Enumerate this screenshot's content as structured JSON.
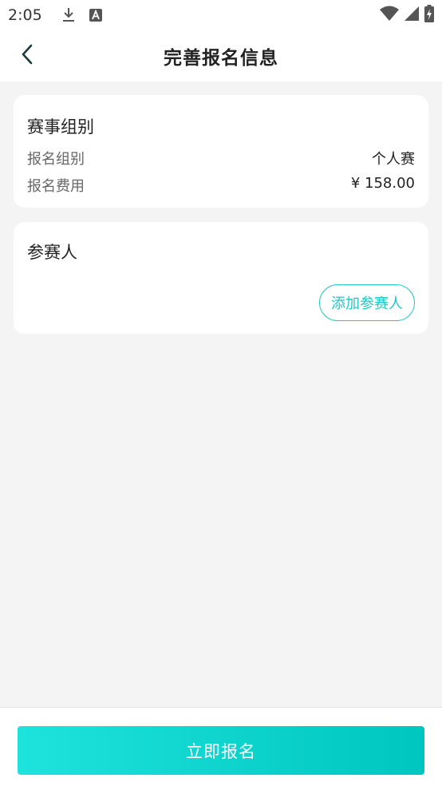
{
  "status_bar": {
    "time": "2:05",
    "icons": [
      "download-icon",
      "font-icon",
      "wifi-icon",
      "signal-icon",
      "battery-charging-icon"
    ]
  },
  "header": {
    "title": "完善报名信息",
    "back_icon": "chevron-left-icon"
  },
  "group_card": {
    "title": "赛事组别",
    "rows": [
      {
        "label": "报名组别",
        "value": "个人赛"
      },
      {
        "label": "报名费用",
        "value": "¥ 158.00"
      }
    ]
  },
  "participants_card": {
    "title": "参赛人",
    "add_button_label": "添加参赛人"
  },
  "footer": {
    "submit_label": "立即报名"
  },
  "colors": {
    "accent": "#1ec8c4",
    "gradient_start": "#1ee3dd",
    "gradient_end": "#00c6c0",
    "background": "#f4f4f4"
  }
}
